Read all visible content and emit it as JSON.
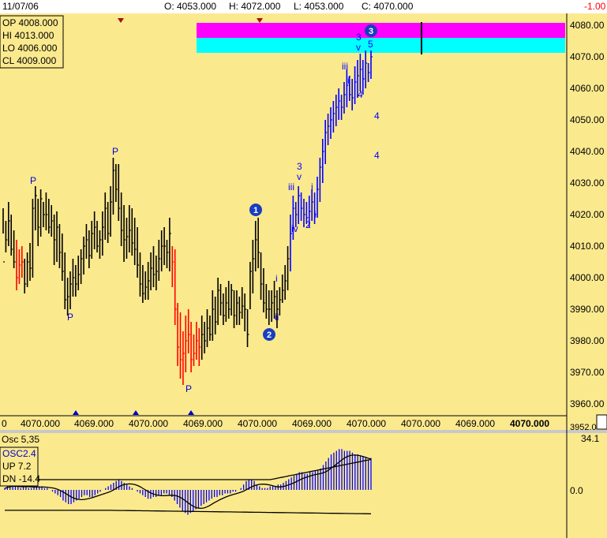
{
  "header": {
    "date": "11/07/06",
    "open": "O: 4053.000",
    "high": "H: 4072.000",
    "low": "L: 4053.000",
    "close": "C: 4070.000",
    "change": "-1.00"
  },
  "ohlc_box": {
    "op": "OP 4008.000",
    "hi": "HI  4013.000",
    "lo": "LO  4006.000",
    "cl": "CL  4009.000"
  },
  "colors": {
    "background": "#fbe98e",
    "up_bar": "#000000",
    "down_bar": "#ff0000",
    "wave_blue": "#0000ff",
    "magenta": "#ff00ff",
    "cyan": "#00ffff",
    "osc_bar": "#0000ff"
  },
  "price_axis": {
    "ticks": [
      "4080.00",
      "4070.00",
      "4060.00",
      "4050.00",
      "4040.00",
      "4030.00",
      "4020.00",
      "4010.00",
      "4000.00",
      "3990.00",
      "3980.00",
      "3970.00",
      "3960.00",
      "3952.0"
    ]
  },
  "bottom_axis": {
    "labels": [
      "0",
      "4070.000",
      "4069.000",
      "4070.000",
      "4069.000",
      "4070.000",
      "4069.000",
      "4070.000",
      "4070.000",
      "4069.000",
      "4070.000"
    ]
  },
  "oscillator": {
    "header": "Osc 5,35",
    "name": "OSC2.4",
    "up": "UP  7.2",
    "dn": "DN  -14.4",
    "top_value": "34.1",
    "zero_value": "0.0"
  },
  "annotations": {
    "p": "P",
    "wave_1": "1",
    "wave_2": "2",
    "wave_3": "3",
    "i": "i",
    "ii": "ii",
    "iii": "iii",
    "iv": "iv",
    "v": "v",
    "num_2": "2",
    "num_3": "3",
    "num_4": "4",
    "num_5": "5"
  },
  "chart_data": {
    "type": "bar",
    "price_range": [
      3952,
      4084
    ],
    "bars": [
      [
        4022,
        4014,
        4005
      ],
      [
        4018,
        4008,
        4012
      ],
      [
        4024,
        4010,
        4018
      ],
      [
        4020,
        4007,
        4009
      ],
      [
        4015,
        4003,
        4005
      ],
      [
        4012,
        3996,
        4000
      ],
      [
        4009,
        3998,
        4004
      ],
      [
        4010,
        4000,
        4005
      ],
      [
        4006,
        3995,
        3998
      ],
      [
        4008,
        3997,
        4005
      ],
      [
        4011,
        3999,
        4003
      ],
      [
        4025,
        4000,
        4022
      ],
      [
        4029,
        4015,
        4026
      ],
      [
        4025,
        4010,
        4016
      ],
      [
        4028,
        4013,
        4025
      ],
      [
        4024,
        4016,
        4020
      ],
      [
        4027,
        4015,
        4020
      ],
      [
        4025,
        4014,
        4016
      ],
      [
        4023,
        4013,
        4018
      ],
      [
        4020,
        4004,
        4012
      ],
      [
        4021,
        4005,
        4016
      ],
      [
        4017,
        4003,
        4008
      ],
      [
        4014,
        3999,
        4002
      ],
      [
        4008,
        3990,
        3993
      ],
      [
        4000,
        3988,
        3994
      ],
      [
        4002,
        3990,
        3998
      ],
      [
        4006,
        3994,
        4000
      ],
      [
        4004,
        3994,
        3998
      ],
      [
        4007,
        3996,
        4001
      ],
      [
        4009,
        3998,
        4006
      ],
      [
        4013,
        4001,
        4010
      ],
      [
        4017,
        4006,
        4012
      ],
      [
        4015,
        4003,
        4007
      ],
      [
        4018,
        4006,
        4014
      ],
      [
        4021,
        4009,
        4016
      ],
      [
        4018,
        4008,
        4010
      ],
      [
        4015,
        4006,
        4012
      ],
      [
        4021,
        4007,
        4016
      ],
      [
        4027,
        4012,
        4022
      ],
      [
        4024,
        4011,
        4014
      ],
      [
        4029,
        4013,
        4024
      ],
      [
        4038,
        4020,
        4034
      ],
      [
        4036,
        4024,
        4028
      ],
      [
        4036,
        4018,
        4022
      ],
      [
        4027,
        4010,
        4015
      ],
      [
        4023,
        4005,
        4012
      ],
      [
        4019,
        4006,
        4013
      ],
      [
        4023,
        4008,
        4015
      ],
      [
        4022,
        4007,
        4011
      ],
      [
        4019,
        4004,
        4009
      ],
      [
        4016,
        4000,
        4004
      ],
      [
        4008,
        3994,
        3998
      ],
      [
        4004,
        3992,
        3995
      ],
      [
        4002,
        3993,
        3997
      ],
      [
        4005,
        3993,
        3999
      ],
      [
        4008,
        3996,
        4003
      ],
      [
        4010,
        3997,
        4001
      ],
      [
        4007,
        3996,
        4002
      ],
      [
        4012,
        3999,
        4006
      ],
      [
        4015,
        4002,
        4010
      ],
      [
        4016,
        4004,
        4010
      ],
      [
        4012,
        4003,
        4008
      ],
      [
        4019,
        4002,
        4014
      ],
      [
        4010,
        3997,
        4005
      ],
      [
        4009,
        3985,
        3990
      ],
      [
        3992,
        3972,
        3978
      ],
      [
        3989,
        3968,
        3974
      ],
      [
        3983,
        3966,
        3976
      ],
      [
        3988,
        3970,
        3980
      ],
      [
        3990,
        3976,
        3982
      ],
      [
        3986,
        3970,
        3974
      ],
      [
        3982,
        3972,
        3976
      ],
      [
        3986,
        3974,
        3980
      ],
      [
        3984,
        3972,
        3978
      ],
      [
        3988,
        3974,
        3982
      ],
      [
        3986,
        3976,
        3980
      ],
      [
        3990,
        3978,
        3984
      ],
      [
        3988,
        3980,
        3982
      ],
      [
        3996,
        3980,
        3990
      ],
      [
        3994,
        3982,
        3986
      ],
      [
        4000,
        3985,
        3996
      ],
      [
        3998,
        3988,
        3992
      ],
      [
        3995,
        3985,
        3988
      ],
      [
        3997,
        3986,
        3992
      ],
      [
        3999,
        3987,
        3990
      ],
      [
        3998,
        3988,
        3996
      ],
      [
        3996,
        3984,
        3988
      ],
      [
        3996,
        3985,
        3992
      ],
      [
        3994,
        3985,
        3989
      ],
      [
        3997,
        3987,
        3991
      ],
      [
        3995,
        3983,
        3990
      ],
      [
        3990,
        3978,
        3982
      ],
      [
        4005,
        3990,
        4002
      ],
      [
        4012,
        3995,
        4006
      ],
      [
        4018,
        4002,
        4012
      ],
      [
        4019,
        4003,
        4008
      ],
      [
        4008,
        3993,
        3998
      ],
      [
        4003,
        3989,
        3992
      ],
      [
        3998,
        3987,
        3990
      ],
      [
        3996,
        3985,
        3990
      ],
      [
        3996,
        3986,
        3992
      ],
      [
        3999,
        3987,
        3994
      ],
      [
        3996,
        3984,
        3990
      ],
      [
        3997,
        3988,
        3993
      ],
      [
        4001,
        3992,
        3996
      ],
      [
        4004,
        3993,
        3999
      ],
      [
        4010,
        3996,
        4006
      ],
      [
        4020,
        4002,
        4014
      ],
      [
        4026,
        4012,
        4022
      ],
      [
        4024,
        4016,
        4020
      ],
      [
        4029,
        4017,
        4026
      ],
      [
        4027,
        4018,
        4022
      ],
      [
        4025,
        4016,
        4020
      ],
      [
        4024,
        4017,
        4019
      ],
      [
        4026,
        4016,
        4021
      ],
      [
        4028,
        4018,
        4024
      ],
      [
        4027,
        4017,
        4020
      ],
      [
        4032,
        4019,
        4028
      ],
      [
        4038,
        4024,
        4035
      ],
      [
        4044,
        4030,
        4040
      ],
      [
        4050,
        4036,
        4046
      ],
      [
        4052,
        4042,
        4048
      ],
      [
        4054,
        4044,
        4050
      ],
      [
        4056,
        4046,
        4052
      ],
      [
        4058,
        4048,
        4054
      ],
      [
        4060,
        4050,
        4056
      ],
      [
        4058,
        4050,
        4054
      ],
      [
        4062,
        4052,
        4058
      ],
      [
        4066,
        4054,
        4061
      ],
      [
        4064,
        4056,
        4058
      ],
      [
        4063,
        4053,
        4057
      ],
      [
        4067,
        4055,
        4062
      ],
      [
        4069,
        4057,
        4064
      ],
      [
        4071,
        4059,
        4066
      ],
      [
        4069,
        4058,
        4063
      ],
      [
        4072,
        4060,
        4068
      ],
      [
        4068,
        4062,
        4065
      ],
      [
        4072,
        4063,
        4070
      ]
    ],
    "osc_series_range": [
      -14.4,
      7.2
    ],
    "osc_values": [
      1,
      2,
      3,
      3,
      2,
      2,
      1,
      2,
      2,
      1,
      1,
      2,
      3,
      2,
      2,
      1,
      1,
      0,
      -1,
      -2,
      -3,
      -4,
      -6,
      -7,
      -8,
      -8,
      -7,
      -6,
      -5,
      -4,
      -3,
      -3,
      -4,
      -4,
      -3,
      -2,
      -1,
      0,
      1,
      2,
      3,
      4,
      5,
      6,
      5,
      4,
      3,
      2,
      1,
      0,
      -1,
      -2,
      -3,
      -4,
      -5,
      -5,
      -4,
      -4,
      -3,
      -3,
      -2,
      -2,
      -3,
      -4,
      -6,
      -8,
      -10,
      -12,
      -13,
      -14,
      -13,
      -12,
      -11,
      -10,
      -9,
      -8,
      -7,
      -6,
      -5,
      -4,
      -4,
      -3,
      -3,
      -2,
      -2,
      -2,
      -1,
      -1,
      0,
      1,
      3,
      5,
      6,
      6,
      5,
      3,
      2,
      1,
      1,
      1,
      2,
      2,
      2,
      3,
      3,
      4,
      5,
      6,
      7,
      8,
      9,
      10,
      10,
      9,
      9,
      10,
      10,
      11,
      11,
      12,
      14,
      16,
      18,
      20,
      21,
      22,
      23,
      23,
      22,
      22,
      22,
      21,
      20,
      20,
      19,
      19,
      18,
      17,
      18
    ]
  }
}
